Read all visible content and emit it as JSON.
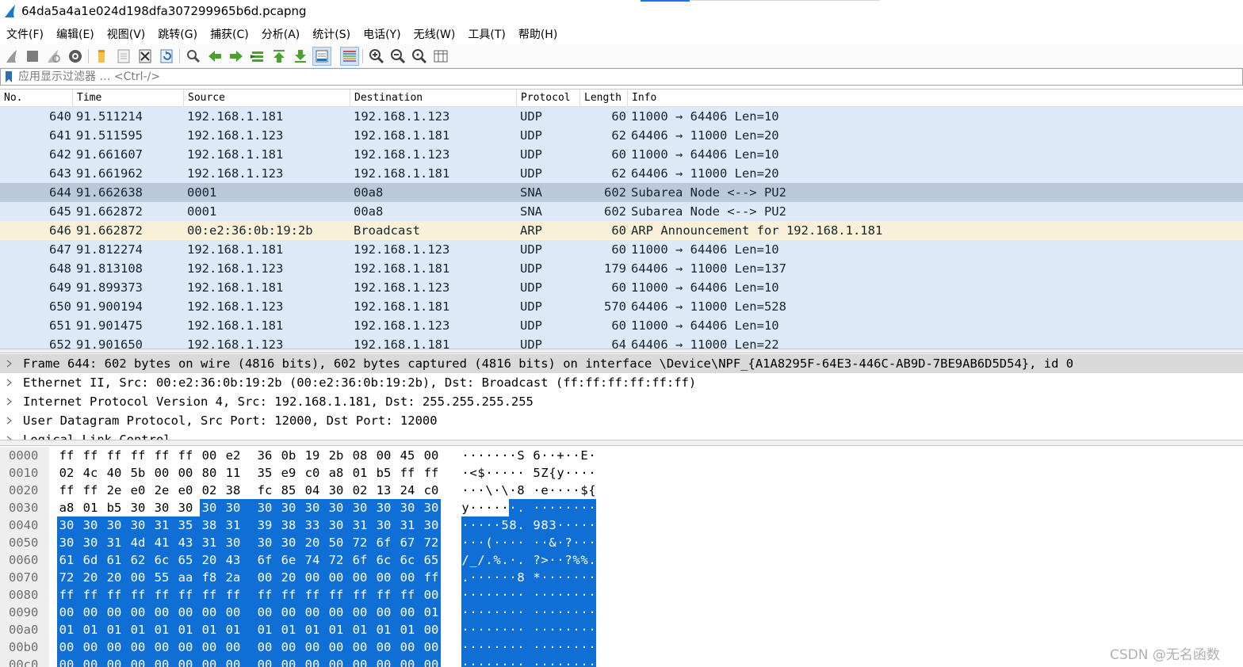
{
  "window": {
    "title": "64da5a4a1e024d198dfa307299965b6d.pcapng",
    "icon": "wireshark-fin-icon"
  },
  "menu": [
    "文件(F)",
    "编辑(E)",
    "视图(V)",
    "跳转(G)",
    "捕获(C)",
    "分析(A)",
    "统计(S)",
    "电话(Y)",
    "无线(W)",
    "工具(T)",
    "帮助(H)"
  ],
  "toolbar": {
    "icons": [
      "start-capture-icon",
      "stop-capture-icon",
      "restart-capture-icon",
      "capture-options-icon",
      "open-file-icon",
      "save-file-icon",
      "close-file-icon",
      "reload-file-icon",
      "find-packet-icon",
      "go-back-icon",
      "go-forward-icon",
      "go-to-packet-icon",
      "go-first-icon",
      "go-last-icon",
      "autoscroll-icon",
      "colorize-icon",
      "zoom-in-icon",
      "zoom-out-icon",
      "zoom-normal-icon",
      "resize-columns-icon"
    ]
  },
  "filter": {
    "placeholder": "应用显示过滤器 … <Ctrl-/>",
    "value": ""
  },
  "packet_list": {
    "columns": [
      "No.",
      "Time",
      "Source",
      "Destination",
      "Protocol",
      "Length",
      "Info"
    ],
    "rows": [
      {
        "no": "640",
        "time": "91.511214",
        "src": "192.168.1.181",
        "dst": "192.168.1.123",
        "proto": "UDP",
        "len": "60",
        "info": "11000 → 64406 Len=10",
        "color": "#dde9f9"
      },
      {
        "no": "641",
        "time": "91.511595",
        "src": "192.168.1.123",
        "dst": "192.168.1.181",
        "proto": "UDP",
        "len": "62",
        "info": "64406 → 11000 Len=20",
        "color": "#dde9f9"
      },
      {
        "no": "642",
        "time": "91.661607",
        "src": "192.168.1.181",
        "dst": "192.168.1.123",
        "proto": "UDP",
        "len": "60",
        "info": "11000 → 64406 Len=10",
        "color": "#dde9f9"
      },
      {
        "no": "643",
        "time": "91.661962",
        "src": "192.168.1.123",
        "dst": "192.168.1.181",
        "proto": "UDP",
        "len": "62",
        "info": "64406 → 11000 Len=20",
        "color": "#dde9f9"
      },
      {
        "no": "644",
        "time": "91.662638",
        "src": "0001",
        "dst": "00a8",
        "proto": "SNA",
        "len": "602",
        "info": "Subarea Node <--> PU2",
        "color": "#b9c9d9",
        "selected": true
      },
      {
        "no": "645",
        "time": "91.662872",
        "src": "0001",
        "dst": "00a8",
        "proto": "SNA",
        "len": "602",
        "info": "Subarea Node <--> PU2",
        "color": "#dde9f9"
      },
      {
        "no": "646",
        "time": "91.662872",
        "src": "00:e2:36:0b:19:2b",
        "dst": "Broadcast",
        "proto": "ARP",
        "len": "60",
        "info": "ARP Announcement for 192.168.1.181",
        "color": "#faf0d7"
      },
      {
        "no": "647",
        "time": "91.812274",
        "src": "192.168.1.181",
        "dst": "192.168.1.123",
        "proto": "UDP",
        "len": "60",
        "info": "11000 → 64406 Len=10",
        "color": "#dde9f9"
      },
      {
        "no": "648",
        "time": "91.813108",
        "src": "192.168.1.123",
        "dst": "192.168.1.181",
        "proto": "UDP",
        "len": "179",
        "info": "64406 → 11000 Len=137",
        "color": "#dde9f9"
      },
      {
        "no": "649",
        "time": "91.899373",
        "src": "192.168.1.181",
        "dst": "192.168.1.123",
        "proto": "UDP",
        "len": "60",
        "info": "11000 → 64406 Len=10",
        "color": "#dde9f9"
      },
      {
        "no": "650",
        "time": "91.900194",
        "src": "192.168.1.123",
        "dst": "192.168.1.181",
        "proto": "UDP",
        "len": "570",
        "info": "64406 → 11000 Len=528",
        "color": "#dde9f9"
      },
      {
        "no": "651",
        "time": "91.901475",
        "src": "192.168.1.181",
        "dst": "192.168.1.123",
        "proto": "UDP",
        "len": "60",
        "info": "11000 → 64406 Len=10",
        "color": "#dde9f9"
      },
      {
        "no": "652",
        "time": "91.901650",
        "src": "192.168.1.123",
        "dst": "192.168.1.181",
        "proto": "UDP",
        "len": "64",
        "info": "64406 → 11000 Len=22",
        "color": "#dde9f9"
      }
    ]
  },
  "details": [
    {
      "text": "Frame 644: 602 bytes on wire (4816 bits), 602 bytes captured (4816 bits) on interface \\Device\\NPF_{A1A8295F-64E3-446C-AB9D-7BE9AB6D5D54}, id 0",
      "selected": true
    },
    {
      "text": "Ethernet II, Src: 00:e2:36:0b:19:2b (00:e2:36:0b:19:2b), Dst: Broadcast (ff:ff:ff:ff:ff:ff)",
      "selected": false
    },
    {
      "text": "Internet Protocol Version 4, Src: 192.168.1.181, Dst: 255.255.255.255",
      "selected": false
    },
    {
      "text": "User Datagram Protocol, Src Port: 12000, Dst Port: 12000",
      "selected": false
    },
    {
      "text": "Logical-Link Control",
      "selected": false
    }
  ],
  "bytes": {
    "highlight_start_index": 54,
    "rows": [
      {
        "offset": "0000",
        "hex": [
          "ff",
          "ff",
          "ff",
          "ff",
          "ff",
          "ff",
          "00",
          "e2",
          "36",
          "0b",
          "19",
          "2b",
          "08",
          "00",
          "45",
          "00"
        ],
        "ascii": [
          "·",
          "·",
          "·",
          "·",
          "·",
          "·",
          "·",
          "S",
          "6",
          "·",
          "·",
          "+",
          "·",
          "·",
          "E",
          "·"
        ]
      },
      {
        "offset": "0010",
        "hex": [
          "02",
          "4c",
          "40",
          "5b",
          "00",
          "00",
          "80",
          "11",
          "35",
          "e9",
          "c0",
          "a8",
          "01",
          "b5",
          "ff",
          "ff"
        ],
        "ascii": [
          "·",
          "<",
          "$",
          "·",
          "·",
          "·",
          "·",
          "·",
          "5",
          "Z",
          "{",
          "y",
          "·",
          "·",
          "·",
          "·"
        ]
      },
      {
        "offset": "0020",
        "hex": [
          "ff",
          "ff",
          "2e",
          "e0",
          "2e",
          "e0",
          "02",
          "38",
          "fc",
          "85",
          "04",
          "30",
          "02",
          "13",
          "24",
          "c0"
        ],
        "ascii": [
          "·",
          "·",
          "·",
          "\\",
          "·",
          "\\",
          "·",
          "8",
          "·",
          "e",
          "·",
          "·",
          "·",
          "·",
          "$",
          "{"
        ]
      },
      {
        "offset": "0030",
        "hex": [
          "a8",
          "01",
          "b5",
          "30",
          "30",
          "30",
          "30",
          "30",
          "30",
          "30",
          "30",
          "30",
          "30",
          "30",
          "30",
          "30"
        ],
        "ascii": [
          "y",
          "·",
          "·",
          "·",
          "·",
          "·",
          "·",
          ".",
          "·",
          "·",
          "·",
          "·",
          "·",
          "·",
          "·",
          "·"
        ]
      },
      {
        "offset": "0040",
        "hex": [
          "30",
          "30",
          "30",
          "30",
          "31",
          "35",
          "38",
          "31",
          "39",
          "38",
          "33",
          "30",
          "31",
          "30",
          "31",
          "30"
        ],
        "ascii": [
          "·",
          "·",
          "·",
          "·",
          "·",
          "5",
          "8",
          ".",
          "9",
          "8",
          "3",
          "·",
          "·",
          "·",
          "·",
          "·"
        ]
      },
      {
        "offset": "0050",
        "hex": [
          "30",
          "30",
          "31",
          "4d",
          "41",
          "43",
          "31",
          "30",
          "30",
          "30",
          "20",
          "50",
          "72",
          "6f",
          "67",
          "72"
        ],
        "ascii": [
          "·",
          "·",
          "·",
          "(",
          "·",
          "·",
          "·",
          "·",
          "·",
          "·",
          "&",
          "·",
          "?",
          "·",
          "·",
          "·"
        ]
      },
      {
        "offset": "0060",
        "hex": [
          "61",
          "6d",
          "61",
          "62",
          "6c",
          "65",
          "20",
          "43",
          "6f",
          "6e",
          "74",
          "72",
          "6f",
          "6c",
          "6c",
          "65"
        ],
        "ascii": [
          "/",
          "_",
          "/",
          ".",
          "%",
          ".",
          "·",
          ".",
          "?",
          ">",
          "·",
          "·",
          "?",
          "%",
          "%",
          "."
        ]
      },
      {
        "offset": "0070",
        "hex": [
          "72",
          "20",
          "20",
          "00",
          "55",
          "aa",
          "f8",
          "2a",
          "00",
          "20",
          "00",
          "00",
          "00",
          "00",
          "00",
          "ff"
        ],
        "ascii": [
          ".",
          "·",
          "·",
          "·",
          "·",
          "·",
          "·",
          "8",
          "*",
          "·",
          "·",
          "·",
          "·",
          "·",
          "·",
          "·"
        ]
      },
      {
        "offset": "0080",
        "hex": [
          "ff",
          "ff",
          "ff",
          "ff",
          "ff",
          "ff",
          "ff",
          "ff",
          "ff",
          "ff",
          "ff",
          "ff",
          "ff",
          "ff",
          "ff",
          "00"
        ],
        "ascii": [
          "·",
          "·",
          "·",
          "·",
          "·",
          "·",
          "·",
          "·",
          "·",
          "·",
          "·",
          "·",
          "·",
          "·",
          "·",
          "·"
        ]
      },
      {
        "offset": "0090",
        "hex": [
          "00",
          "00",
          "00",
          "00",
          "00",
          "00",
          "00",
          "00",
          "00",
          "00",
          "00",
          "00",
          "00",
          "00",
          "00",
          "01"
        ],
        "ascii": [
          "·",
          "·",
          "·",
          "·",
          "·",
          "·",
          "·",
          "·",
          "·",
          "·",
          "·",
          "·",
          "·",
          "·",
          "·",
          "·"
        ]
      },
      {
        "offset": "00a0",
        "hex": [
          "01",
          "01",
          "01",
          "01",
          "01",
          "01",
          "01",
          "01",
          "01",
          "01",
          "01",
          "01",
          "01",
          "01",
          "01",
          "00"
        ],
        "ascii": [
          "·",
          "·",
          "·",
          "·",
          "·",
          "·",
          "·",
          "·",
          "·",
          "·",
          "·",
          "·",
          "·",
          "·",
          "·",
          "·"
        ]
      },
      {
        "offset": "00b0",
        "hex": [
          "00",
          "00",
          "00",
          "00",
          "00",
          "00",
          "00",
          "00",
          "00",
          "00",
          "00",
          "00",
          "00",
          "00",
          "00",
          "00"
        ],
        "ascii": [
          "·",
          "·",
          "·",
          "·",
          "·",
          "·",
          "·",
          "·",
          "·",
          "·",
          "·",
          "·",
          "·",
          "·",
          "·",
          "·"
        ]
      },
      {
        "offset": "00c0",
        "hex": [
          "00",
          "00",
          "00",
          "00",
          "00",
          "00",
          "00",
          "00",
          "00",
          "00",
          "00",
          "00",
          "00",
          "00",
          "00",
          "00"
        ],
        "ascii": [
          "·",
          "·",
          "·",
          "·",
          "·",
          "·",
          "·",
          "·",
          "·",
          "·",
          "·",
          "·",
          "·",
          "·",
          "·",
          "·"
        ]
      }
    ]
  },
  "watermark": "CSDN @无名函数",
  "colors": {
    "udp_row": "#dde9f9",
    "selected_row": "#b9c9d9",
    "arp_row": "#faf0d7",
    "bytes_highlight": "#0f6fd4",
    "details_selected": "#d9d9d9"
  }
}
